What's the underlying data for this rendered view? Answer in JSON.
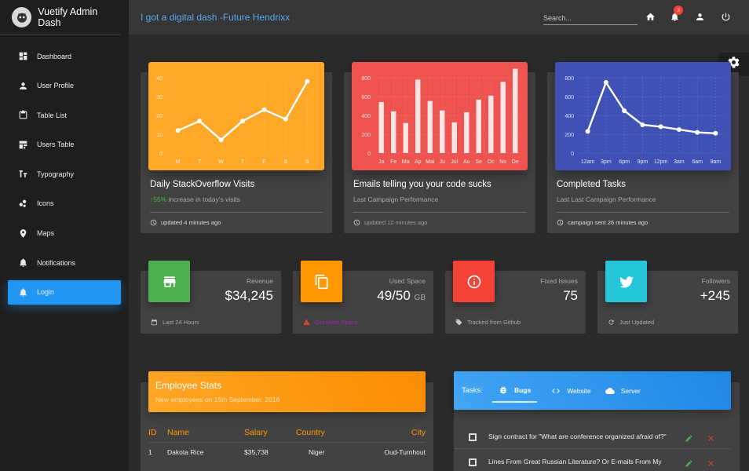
{
  "app": {
    "title": "Vuetify Admin Dash"
  },
  "topbar": {
    "title": "I got a digital dash -Future Hendrixx",
    "search_placeholder": "Search...",
    "notification_count": "3"
  },
  "sidebar": {
    "items": [
      {
        "label": "Dashboard",
        "icon": "dashboard-icon"
      },
      {
        "label": "User Profile",
        "icon": "person-icon"
      },
      {
        "label": "Table List",
        "icon": "clipboard-icon"
      },
      {
        "label": "Users Table",
        "icon": "table-edit-icon"
      },
      {
        "label": "Typography",
        "icon": "typography-icon"
      },
      {
        "label": "Icons",
        "icon": "bubble-chart-icon"
      },
      {
        "label": "Maps",
        "icon": "map-pin-icon"
      },
      {
        "label": "Notifications",
        "icon": "bell-icon"
      },
      {
        "label": "Login",
        "icon": "bell-icon",
        "active": true
      }
    ]
  },
  "cards": {
    "visits": {
      "title": "Daily StackOverflow Visits",
      "up_pct": "55%",
      "sub_rest": " increase in today's visits",
      "footer": "updated 4 minutes ago"
    },
    "emails": {
      "title": "Emails telling you your code sucks",
      "sub": "Last Campaign Performance",
      "footer": "updated 10 minutes ago"
    },
    "tasks": {
      "title": "Completed Tasks",
      "sub": "Last Last Campaign Performance",
      "footer": "campaign sent 26 minutes ago"
    }
  },
  "colors": {
    "orange": "#ffa726",
    "red": "#ef5350",
    "blue": "#3f51b5",
    "green": "#4caf50",
    "cyan": "#26c6da",
    "accent": "#2196f3"
  },
  "chart_data": [
    {
      "type": "line",
      "categories": [
        "M",
        "T",
        "W",
        "T",
        "F",
        "S",
        "S"
      ],
      "values": [
        12,
        17,
        7,
        17,
        23,
        18,
        38
      ],
      "ylim": [
        0,
        40
      ],
      "yticks": [
        "0",
        "10",
        "20",
        "30",
        "40"
      ],
      "grid": true
    },
    {
      "type": "bar",
      "categories": [
        "Ja",
        "Fe",
        "Ma",
        "Ap",
        "Mai",
        "Ju",
        "Jul",
        "Au",
        "Se",
        "Oc",
        "No",
        "De"
      ],
      "values": [
        542,
        443,
        320,
        780,
        553,
        453,
        326,
        434,
        568,
        610,
        756,
        895
      ],
      "ylim": [
        0,
        800
      ],
      "yticks": [
        "0",
        "200",
        "400",
        "600",
        "800"
      ],
      "grid": true
    },
    {
      "type": "line",
      "categories": [
        "12am",
        "3pm",
        "6pm",
        "9pm",
        "12pm",
        "3am",
        "6am",
        "9am"
      ],
      "values": [
        230,
        750,
        450,
        300,
        280,
        250,
        220,
        210
      ],
      "ylim": [
        0,
        800
      ],
      "yticks": [
        "0",
        "200",
        "400",
        "600",
        "800"
      ],
      "grid": true
    }
  ],
  "stats": [
    {
      "label": "Revenue",
      "value": "$34,245",
      "unit": "",
      "footer": "Last 24 Hours",
      "icon": "store-icon",
      "color": "#4caf50"
    },
    {
      "label": "Used Space",
      "value": "49/50",
      "unit": "GB",
      "footer": "Get More Space...",
      "icon": "content-copy-icon",
      "color": "#ff9800"
    },
    {
      "label": "Fixed Issues",
      "value": "75",
      "unit": "",
      "footer": "Tracked from Github",
      "icon": "info-icon",
      "color": "#f44336"
    },
    {
      "label": "Followers",
      "value": "+245",
      "unit": "",
      "footer": "Just Updated",
      "icon": "twitter-icon",
      "color": "#00acc1"
    }
  ],
  "employees": {
    "title": "Employee Stats",
    "subtitle": "New employees on 15th September, 2016",
    "headers": [
      "ID",
      "Name",
      "Salary",
      "Country",
      "City"
    ],
    "rows": [
      [
        "1",
        "Dakota Rice",
        "$35,738",
        "Niger",
        "Oud-Turnhout"
      ]
    ]
  },
  "task_panel": {
    "label": "Tasks:",
    "tabs": [
      "Bugs",
      "Website",
      "Server"
    ],
    "items": [
      "Sign contract for \"What are conference organized afraid of?\"",
      "Lines From Great Russian Literature? Or E-mails From My"
    ]
  }
}
